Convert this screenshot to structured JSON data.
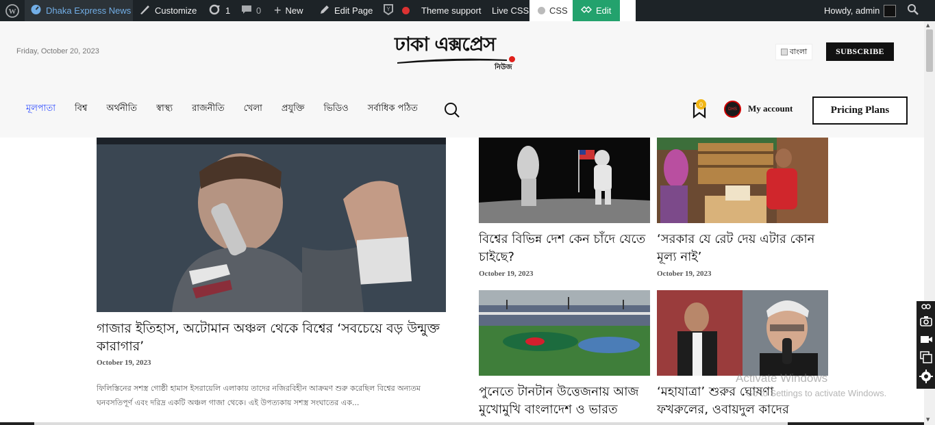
{
  "adminbar": {
    "site_name": "Dhaka Express News",
    "customize": "Customize",
    "updates_count": "1",
    "comments_count": "0",
    "new_label": "New",
    "edit_page": "Edit Page",
    "theme_support": "Theme support",
    "live_css": "Live CSS",
    "css": "CSS",
    "edit": "Edit",
    "howdy": "Howdy, admin"
  },
  "header": {
    "date": "Friday, October 20, 2023",
    "logo_main": "ঢাকা এক্সপ্রেস",
    "logo_sub": "নিউজ",
    "language": "বাংলা",
    "subscribe": "SUBSCRIBE",
    "bookmark_count": "0",
    "avatar_text": "DHS",
    "my_account": "My account",
    "pricing_plans": "Pricing Plans"
  },
  "nav": {
    "items": [
      "মূলপাতা",
      "বিশ্ব",
      "অর্থনীতি",
      "স্বাস্থ্য",
      "রাজনীতি",
      "খেলা",
      "প্রযুক্তি",
      "ভিডিও",
      "সর্বাধিক পঠিত"
    ]
  },
  "hero": {
    "title": "গাজার ইতিহাস, অটোমান অঞ্চল থেকে বিশ্বের ‘সবচেয়ে বড় উন্মুক্ত কারাগার’",
    "date": "October 19, 2023",
    "excerpt": "ফিলিস্তিনের সশস্ত্র গোষ্ঠী হামাস ইসরায়েলি এলাকায় তাদের নজিরবিহীন আক্রমণ শুরু করেছিল বিশ্বের অন্যতম ঘনবসতিপূর্ণ এবং দরিদ্র একটি অঞ্চল গাজা থেকে। এই উপত্যকায় সশস্ত্র সংঘাতের এক..."
  },
  "cards": [
    {
      "title": "বিশ্বের বিভিন্ন দেশ কেন চাঁদে যেতে চাইছে?",
      "date": "October 19, 2023"
    },
    {
      "title": "‘সরকার যে রেট দেয় এটার কোন মূল্য নাই’",
      "date": "October 19, 2023"
    },
    {
      "title": "পুনেতে টানটান উত্তেজনায় আজ মুখোমুখি বাংলাদেশ ও ভারত",
      "date": ""
    },
    {
      "title": "‘মহাযাত্রা’ শুরুর ঘোষণা ফখরুলের, ওবায়দুল কাদের",
      "date": ""
    }
  ],
  "watermark": {
    "line1": "Activate Windows",
    "line2": "Go to Settings to activate Windows."
  },
  "colors": {
    "adminbar_bg": "#1d2327",
    "nav_active": "#2f4cff",
    "edit_green": "#23a26d",
    "badge": "#f1b514",
    "logo_dot": "#e0201b"
  }
}
